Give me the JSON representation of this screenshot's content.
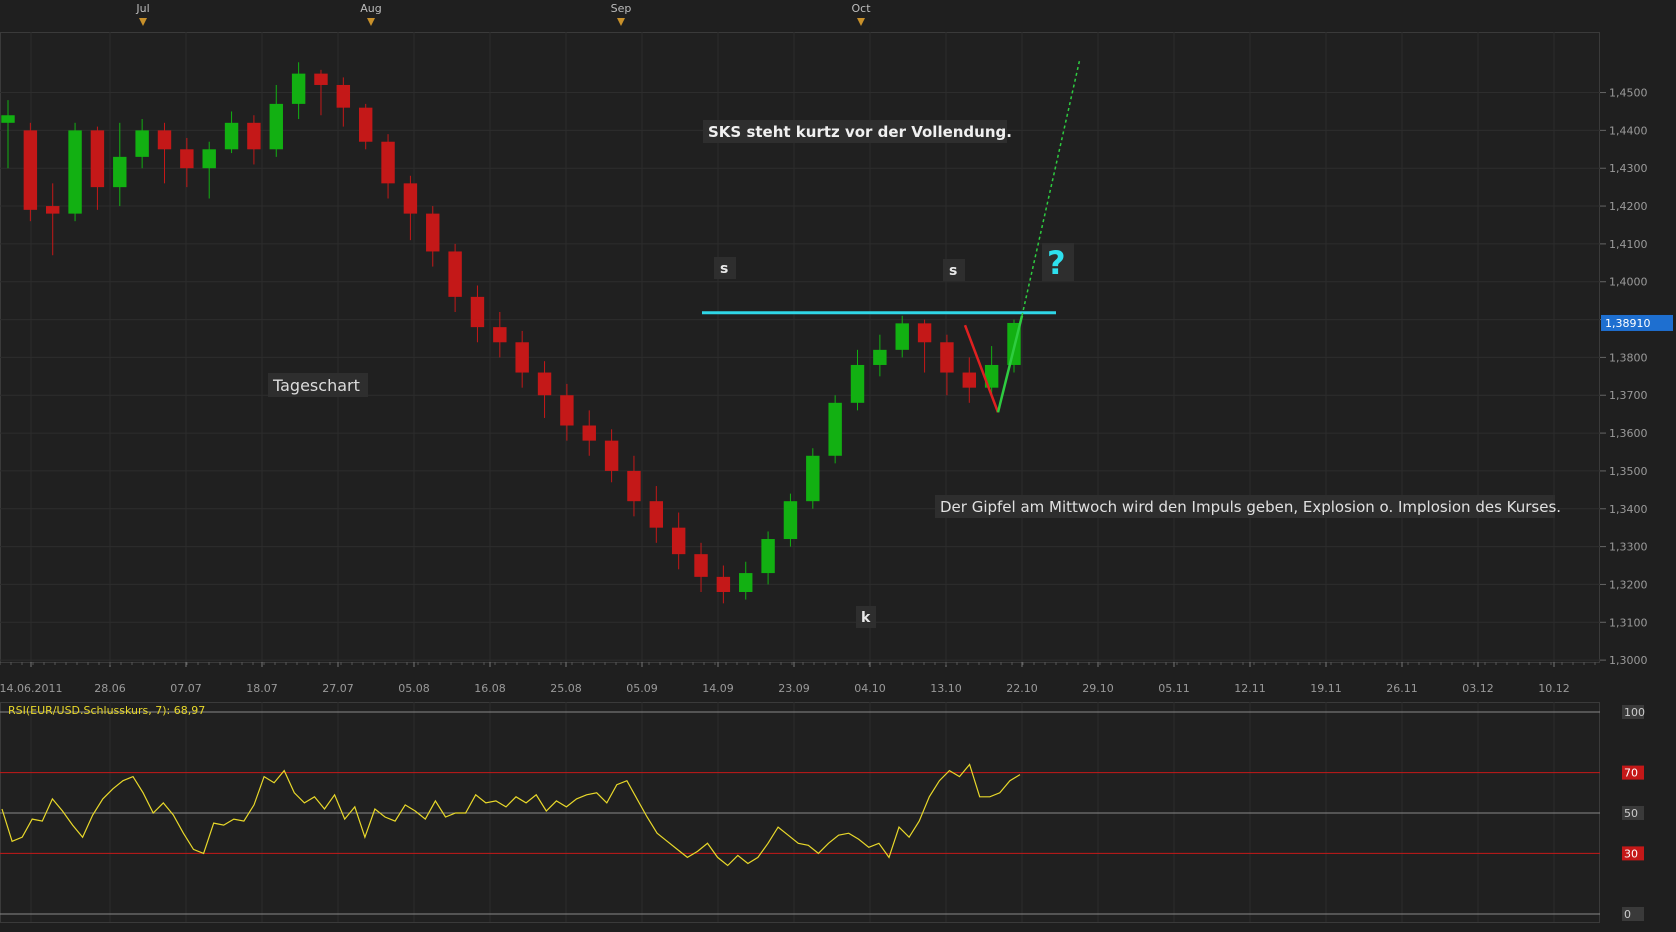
{
  "chart_data": [
    {
      "type": "candlestick",
      "instrument": "EUR/USD",
      "month_labels": [
        "Jul",
        "Aug",
        "Sep",
        "Oct"
      ],
      "x_tick_labels": [
        "14.06.2011",
        "28.06",
        "07.07",
        "18.07",
        "27.07",
        "05.08",
        "16.08",
        "25.08",
        "05.09",
        "14.09",
        "23.09",
        "04.10",
        "13.10",
        "22.10",
        "29.10",
        "05.11",
        "12.11",
        "19.11",
        "26.11",
        "03.12",
        "10.12"
      ],
      "y_tick_labels": [
        "1,4500",
        "1,4400",
        "1,4300",
        "1,4200",
        "1,4100",
        "1,4000",
        "1,3900",
        "1,3800",
        "1,3700",
        "1,3600",
        "1,3500",
        "1,3400",
        "1,3300",
        "1,3200",
        "1,3100",
        "1,3000"
      ],
      "y_ticks": [
        1.45,
        1.44,
        1.43,
        1.42,
        1.41,
        1.4,
        1.39,
        1.38,
        1.37,
        1.36,
        1.35,
        1.34,
        1.33,
        1.32,
        1.31,
        1.3
      ],
      "ylim": [
        1.2995,
        1.466
      ],
      "last_price": 1.3891,
      "last_price_label": "1,38910",
      "candles": [
        [
          1.442,
          1.444,
          1.448,
          1.43
        ],
        [
          1.44,
          1.419,
          1.442,
          1.416
        ],
        [
          1.42,
          1.418,
          1.426,
          1.407
        ],
        [
          1.418,
          1.44,
          1.442,
          1.416
        ],
        [
          1.44,
          1.425,
          1.441,
          1.419
        ],
        [
          1.425,
          1.433,
          1.442,
          1.42
        ],
        [
          1.433,
          1.44,
          1.443,
          1.43
        ],
        [
          1.44,
          1.435,
          1.442,
          1.426
        ],
        [
          1.435,
          1.43,
          1.438,
          1.425
        ],
        [
          1.43,
          1.435,
          1.437,
          1.422
        ],
        [
          1.435,
          1.442,
          1.445,
          1.434
        ],
        [
          1.442,
          1.435,
          1.444,
          1.431
        ],
        [
          1.435,
          1.447,
          1.452,
          1.433
        ],
        [
          1.447,
          1.455,
          1.458,
          1.443
        ],
        [
          1.455,
          1.452,
          1.456,
          1.444
        ],
        [
          1.452,
          1.446,
          1.454,
          1.441
        ],
        [
          1.446,
          1.437,
          1.447,
          1.435
        ],
        [
          1.437,
          1.426,
          1.439,
          1.422
        ],
        [
          1.426,
          1.418,
          1.428,
          1.411
        ],
        [
          1.418,
          1.408,
          1.42,
          1.404
        ],
        [
          1.408,
          1.396,
          1.41,
          1.392
        ],
        [
          1.396,
          1.388,
          1.399,
          1.384
        ],
        [
          1.388,
          1.384,
          1.392,
          1.38
        ],
        [
          1.384,
          1.376,
          1.387,
          1.372
        ],
        [
          1.376,
          1.37,
          1.379,
          1.364
        ],
        [
          1.37,
          1.362,
          1.373,
          1.358
        ],
        [
          1.362,
          1.358,
          1.366,
          1.354
        ],
        [
          1.358,
          1.35,
          1.361,
          1.347
        ],
        [
          1.35,
          1.342,
          1.354,
          1.338
        ],
        [
          1.342,
          1.335,
          1.346,
          1.331
        ],
        [
          1.335,
          1.328,
          1.339,
          1.324
        ],
        [
          1.328,
          1.322,
          1.331,
          1.318
        ],
        [
          1.322,
          1.318,
          1.325,
          1.315
        ],
        [
          1.318,
          1.323,
          1.326,
          1.316
        ],
        [
          1.323,
          1.332,
          1.334,
          1.32
        ],
        [
          1.332,
          1.342,
          1.344,
          1.33
        ],
        [
          1.342,
          1.354,
          1.356,
          1.34
        ],
        [
          1.354,
          1.368,
          1.37,
          1.352
        ],
        [
          1.368,
          1.378,
          1.382,
          1.366
        ],
        [
          1.378,
          1.382,
          1.386,
          1.375
        ],
        [
          1.382,
          1.389,
          1.391,
          1.38
        ],
        [
          1.389,
          1.384,
          1.39,
          1.376
        ],
        [
          1.384,
          1.376,
          1.386,
          1.37
        ],
        [
          1.376,
          1.372,
          1.38,
          1.368
        ],
        [
          1.372,
          1.378,
          1.383,
          1.37
        ],
        [
          1.378,
          1.3891,
          1.39,
          1.376
        ]
      ],
      "annotations": {
        "headline": "SKS steht kurtz vor der Vollendung.",
        "timeframe": "Tageschart",
        "shoulder_left": "s",
        "shoulder_right": "s",
        "head": "k",
        "question": "?",
        "comment": "Der Gipfel am Mittwoch wird den Impuls geben, Explosion o. Implosion des Kurses."
      },
      "colors": {
        "up": "#12b012",
        "down": "#c41818",
        "neckline": "#2fd6e6",
        "projection": "#2ecc40",
        "last_price_bg": "#1e6fd0"
      }
    },
    {
      "type": "line",
      "title": "RSI(EUR/USD.Schlusskurs, 7): 68,97",
      "y_tick_labels": [
        "100",
        "70",
        "50",
        "30",
        "0"
      ],
      "levels": [
        100,
        70,
        50,
        30,
        0
      ],
      "ylim": [
        0,
        100
      ],
      "series": [
        {
          "name": "RSI(EUR/USD.Schlusskurs, 7)",
          "values": [
            52,
            36,
            38,
            47,
            46,
            57,
            51,
            44,
            38,
            49,
            57,
            62,
            66,
            68,
            60,
            50,
            55,
            49,
            40,
            32,
            30,
            45,
            44,
            47,
            46,
            54,
            68,
            65,
            71,
            60,
            55,
            58,
            52,
            59,
            47,
            53,
            38,
            52,
            48,
            46,
            54,
            51,
            47,
            56,
            48,
            50,
            50,
            59,
            55,
            56,
            53,
            58,
            55,
            59,
            51,
            56,
            53,
            57,
            59,
            60,
            55,
            64,
            66,
            57,
            48,
            40,
            36,
            32,
            28,
            31,
            35,
            28,
            24,
            29,
            25,
            28,
            35,
            43,
            39,
            35,
            34,
            30,
            35,
            39,
            40,
            37,
            33,
            35,
            28,
            43,
            38,
            46,
            58,
            66,
            71,
            68,
            74,
            58,
            58,
            60,
            66,
            69
          ]
        }
      ],
      "color": "#e8d82a"
    }
  ]
}
